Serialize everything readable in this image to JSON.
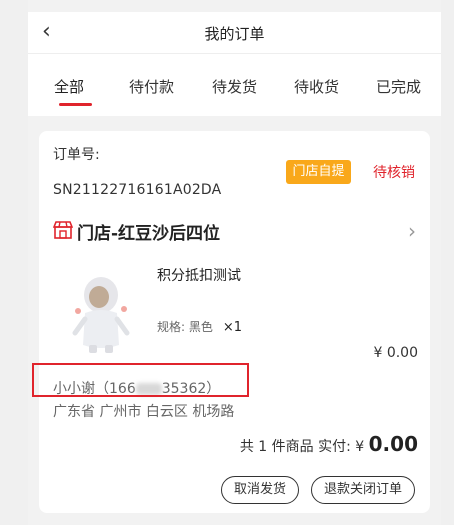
{
  "header": {
    "back_icon": "chevron-left-icon",
    "title": "我的订单"
  },
  "tabs": [
    {
      "label": "全部",
      "active": true
    },
    {
      "label": "待付款"
    },
    {
      "label": "待发货"
    },
    {
      "label": "待收货"
    },
    {
      "label": "已完成"
    }
  ],
  "order": {
    "number_label": "订单号:",
    "number": "SN21122716161A02DA",
    "pickup_badge": "门店自提",
    "status": "待核销",
    "store_icon": "store-icon",
    "store_name": "门店-红豆沙后四位",
    "product": {
      "name": "积分抵扣测试",
      "spec": "规格: 黑色",
      "qty": "×1",
      "price": "¥ 0.00"
    },
    "contact_prefix": "小小谢（166",
    "contact_suffix": "35362）",
    "address": "广东省 广州市 白云区 机场路",
    "summary_text": "共 1 件商品 实付:",
    "currency": "¥",
    "total": "0.00",
    "buttons": {
      "cancel": "取消发货",
      "refund": "退款关闭订单"
    }
  },
  "colors": {
    "accent": "#e0242c",
    "badge": "#f9a81a"
  }
}
